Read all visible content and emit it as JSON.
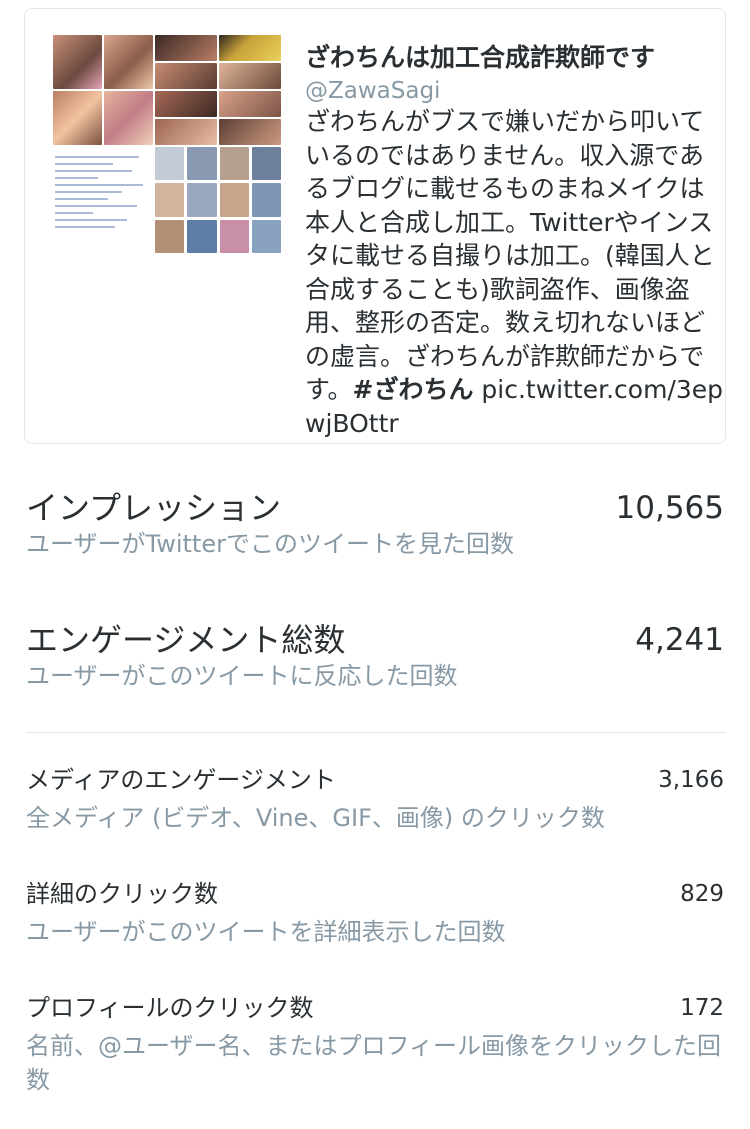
{
  "tweet": {
    "name": "ざわちんは加工合成詐欺師です",
    "handle": "@ZawaSagi",
    "text_main": "ざわちんがブスで嫌いだから叩いているのではありません。収入源であるブログに載せるものまねメイクは本人と合成し加工。Twitterやインスタに載せる自撮りは加工。(韓国人と合成することも)歌詞盗作、画像盗用、整形の否定。数え切れないほどの虚言。ざわちんが詐欺師だからです。",
    "hashtag": "#ざわちん",
    "link": " pic.twitter.com/3epwjBOttr"
  },
  "metrics": [
    {
      "label": "インプレッション",
      "value": "10,565",
      "desc": "ユーザーがTwitterでこのツイートを見た回数"
    },
    {
      "label": "エンゲージメント総数",
      "value": "4,241",
      "desc": "ユーザーがこのツイートに反応した回数"
    },
    {
      "label": "メディアのエンゲージメント",
      "value": "3,166",
      "desc": "全メディア (ビデオ、Vine、GIF、画像) のクリック数"
    },
    {
      "label": "詳細のクリック数",
      "value": "829",
      "desc": "ユーザーがこのツイートを詳細表示した回数"
    },
    {
      "label": "プロフィールのクリック数",
      "value": "172",
      "desc": "名前、@ユーザー名、またはプロフィール画像をクリックした回数"
    }
  ],
  "colors": {
    "primary_text": "#292f33",
    "secondary_text": "#8899a6",
    "border": "#e1e8ed"
  }
}
